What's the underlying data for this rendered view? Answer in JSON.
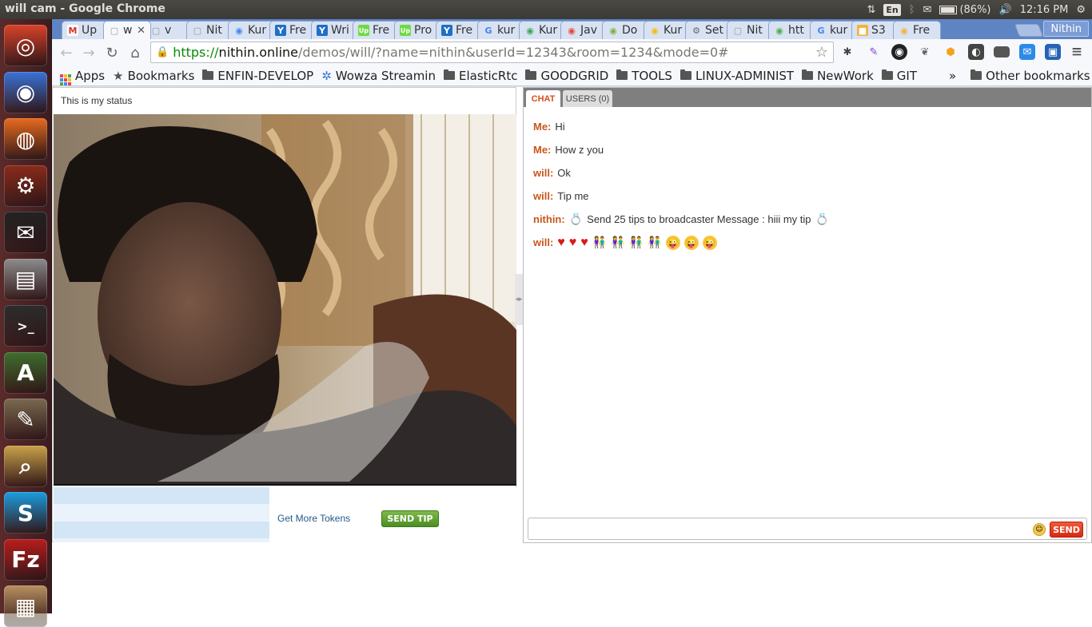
{
  "system": {
    "window_title": "will cam - Google Chrome",
    "lang": "En",
    "battery": "(86%)",
    "time": "12:16 PM"
  },
  "launcher": [
    {
      "name": "ubuntu-logo-icon",
      "color": "#d9432a"
    },
    {
      "name": "chrome-icon",
      "color": "#3a73d6"
    },
    {
      "name": "firefox-icon",
      "color": "#e66b1e"
    },
    {
      "name": "settings-icon",
      "color": "#8a2b1a"
    },
    {
      "name": "pidgin-icon",
      "color": "#222222"
    },
    {
      "name": "files-icon",
      "color": "#8c8c8c"
    },
    {
      "name": "terminal-icon",
      "color": "#2c2c2c"
    },
    {
      "name": "updater-icon",
      "color": "#3e6e2e"
    },
    {
      "name": "gimp-icon",
      "color": "#7a6a50"
    },
    {
      "name": "image-viewer-icon",
      "color": "#c9a24a"
    },
    {
      "name": "skype-icon",
      "color": "#1a9de0"
    },
    {
      "name": "filezilla-icon",
      "color": "#b81c1c"
    },
    {
      "name": "unknown-app-icon",
      "color": "#b89060"
    }
  ],
  "tabs": [
    {
      "label": "Up",
      "fav": "M",
      "favcolor": "#d93025"
    },
    {
      "label": "w",
      "fav": "▢",
      "favcolor": "#999999",
      "active": true
    },
    {
      "label": "v",
      "fav": "▢",
      "favcolor": "#999999"
    },
    {
      "label": "Nit",
      "fav": "▢",
      "favcolor": "#999999"
    },
    {
      "label": "Kur",
      "fav": "◉",
      "favcolor": "#4285f4"
    },
    {
      "label": "Fre",
      "fav": "Y",
      "favcolor": "#1f6fc5"
    },
    {
      "label": "Wri",
      "fav": "Y",
      "favcolor": "#1f6fc5"
    },
    {
      "label": "Fre",
      "fav": "Up",
      "favcolor": "#6fda44"
    },
    {
      "label": "Pro",
      "fav": "Up",
      "favcolor": "#6fda44"
    },
    {
      "label": "Fre",
      "fav": "Y",
      "favcolor": "#1f6fc5"
    },
    {
      "label": "kur",
      "fav": "G",
      "favcolor": "#4285f4"
    },
    {
      "label": "Kur",
      "fav": "◉",
      "favcolor": "#34a853"
    },
    {
      "label": "Jav",
      "fav": "◉",
      "favcolor": "#ea4335"
    },
    {
      "label": "Do",
      "fav": "◉",
      "favcolor": "#7cb342"
    },
    {
      "label": "Kur",
      "fav": "◉",
      "favcolor": "#fbbc05"
    },
    {
      "label": "Set",
      "fav": "⚙",
      "favcolor": "#666666"
    },
    {
      "label": "Nit",
      "fav": "▢",
      "favcolor": "#999999"
    },
    {
      "label": "htt",
      "fav": "◉",
      "favcolor": "#4caf50"
    },
    {
      "label": "kur",
      "fav": "G",
      "favcolor": "#4285f4"
    },
    {
      "label": "S3",
      "fav": "■",
      "favcolor": "#f3b33d"
    },
    {
      "label": "Fre",
      "fav": "◉",
      "favcolor": "#f3b33d"
    }
  ],
  "profile": "Nithin",
  "url": {
    "scheme": "https://",
    "host": "nithin.online",
    "path": "/demos/will/?name=nithin&userId=12343&room=1234&mode=0#"
  },
  "bookmarks": [
    {
      "label": "Apps",
      "kind": "apps"
    },
    {
      "label": "Bookmarks",
      "kind": "star"
    },
    {
      "label": "ENFIN-DEVELOP",
      "kind": "folder"
    },
    {
      "label": "Wowza Streamin",
      "kind": "wowza"
    },
    {
      "label": "ElasticRtc",
      "kind": "folder"
    },
    {
      "label": "GOODGRID",
      "kind": "folder"
    },
    {
      "label": "TOOLS",
      "kind": "folder"
    },
    {
      "label": "LINUX-ADMINIST",
      "kind": "folder"
    },
    {
      "label": "NewWork",
      "kind": "folder"
    },
    {
      "label": "GIT",
      "kind": "folder"
    }
  ],
  "bookmarks_more": "»",
  "bookmarks_other": "Other bookmarks",
  "page": {
    "status": "This is my status",
    "more_tokens": "Get More Tokens",
    "send_tip": "SEND TIP",
    "tab_chat": "CHAT",
    "tab_users": "USERS (0)",
    "send": "SEND"
  },
  "chat": [
    {
      "who": "Me:",
      "text": "Hi"
    },
    {
      "who": "Me:",
      "text": "How z you"
    },
    {
      "who": "will:",
      "text": "Ok"
    },
    {
      "who": "will:",
      "text": "Tip me"
    },
    {
      "who": "nithin:",
      "text": "Send 25 tips to broadcaster Message : hiii my tip",
      "ring": true
    },
    {
      "who": "will:",
      "emojis": [
        "heart",
        "heart",
        "heart",
        "couple",
        "couple",
        "couple",
        "couple",
        "tongue",
        "tongue",
        "tongue"
      ]
    }
  ]
}
